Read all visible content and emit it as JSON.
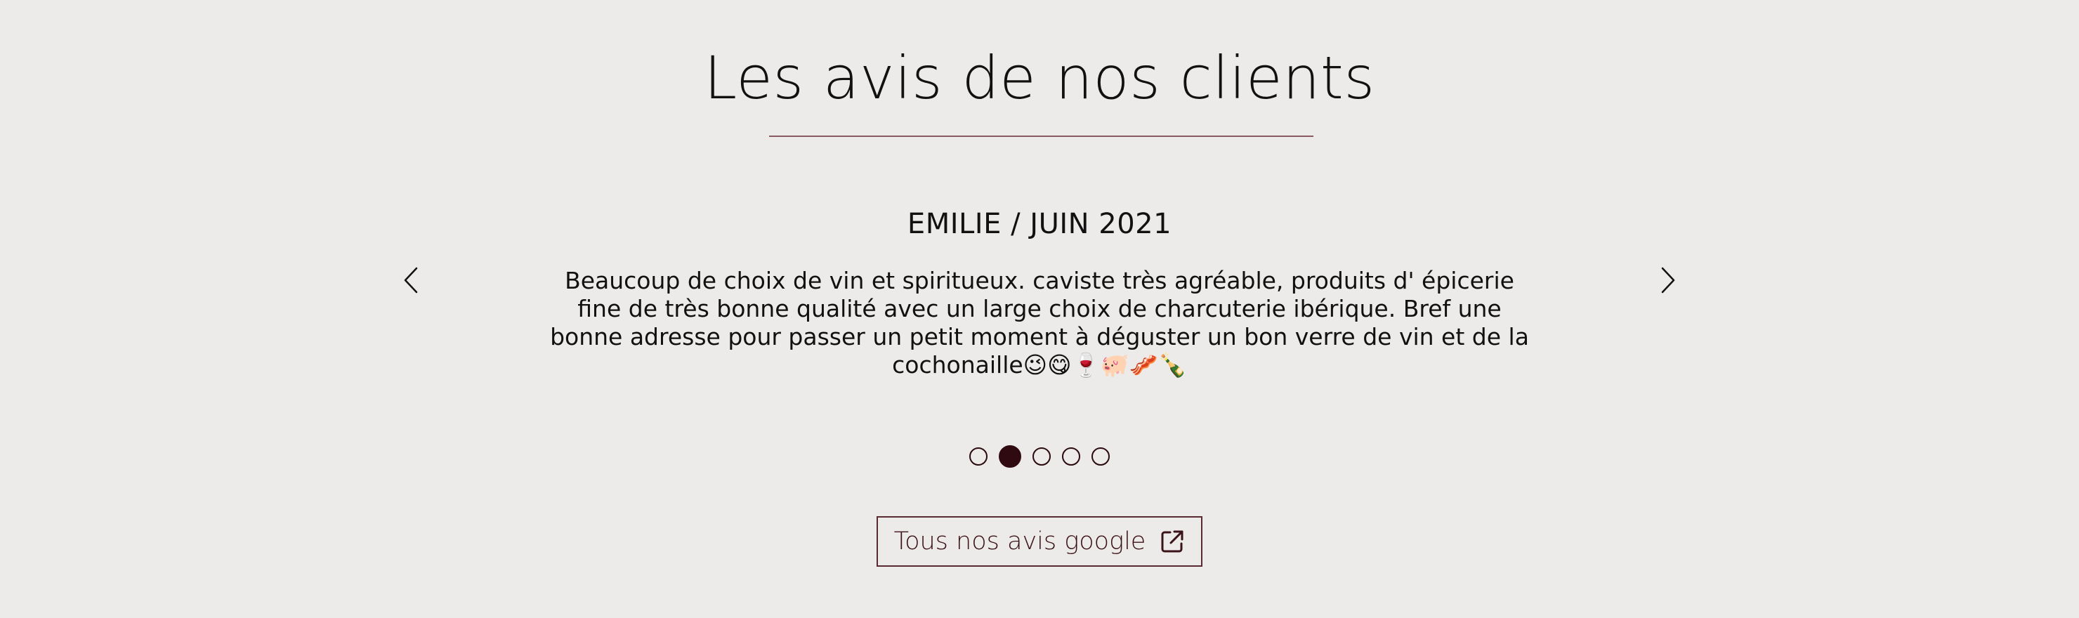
{
  "section": {
    "title": "Les avis de nos clients"
  },
  "carousel": {
    "author": "EMILIE / JUIN 2021",
    "text": "Beaucoup de choix de vin et spiritueux. caviste très agréable, produits d' épicerie fine de très bonne qualité avec un large choix de charcuterie ibérique. Bref une bonne adresse pour passer un petit moment à déguster un bon verre de vin et de la cochonaille😉😋🍷🐖🥓🍾",
    "prev_icon": "chevron-left-icon",
    "next_icon": "chevron-right-icon",
    "slide_count": 5,
    "active_slide": 2
  },
  "cta": {
    "label": "Tous nos avis google",
    "icon": "external-link-icon"
  },
  "colors": {
    "background": "#edebe9",
    "accent": "#2f0a10",
    "rule": "#8a5a63"
  }
}
